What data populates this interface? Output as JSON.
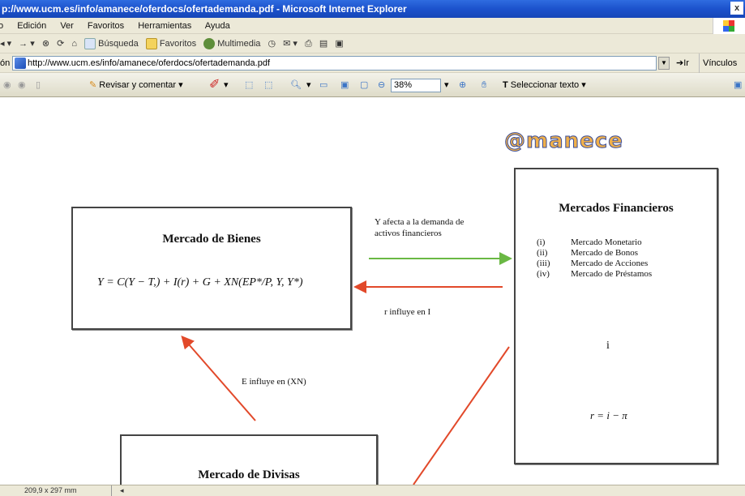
{
  "window": {
    "title": "p://www.ucm.es/info/amanece/oferdocs/ofertademanda.pdf - Microsoft Internet Explorer",
    "close": "x"
  },
  "menu": [
    "o",
    "Edición",
    "Ver",
    "Favoritos",
    "Herramientas",
    "Ayuda"
  ],
  "toolbar": {
    "search": "Búsqueda",
    "favorites": "Favoritos",
    "multimedia": "Multimedia"
  },
  "address": {
    "label": "ón",
    "url": "http://www.ucm.es/info/amanece/oferdocs/ofertademanda.pdf",
    "go": "Ir",
    "links": "Vínculos"
  },
  "pdf_toolbar": {
    "review": "Revisar y comentar",
    "zoom": "38%",
    "select_text": "Seleccionar texto"
  },
  "document": {
    "logo": "@manece",
    "bienes": {
      "title": "Mercado de Bienes",
      "formula": "Y = C(Y − T,) + I(r) + G + XN(EP*/P, Y, Y*)"
    },
    "financieros": {
      "title": "Mercados Financieros",
      "items": [
        {
          "num": "(i)",
          "label": "Mercado Monetario"
        },
        {
          "num": "(ii)",
          "label": "Mercado de Bonos"
        },
        {
          "num": "(iii)",
          "label": "Mercado de Acciones"
        },
        {
          "num": "(iv)",
          "label": "Mercado de Préstamos"
        }
      ],
      "i_label": "i",
      "r_formula": "r = i − π"
    },
    "divisas": {
      "title": "Mercado de Divisas"
    },
    "arrows": {
      "y_affects_line1": "Y afecta a la demanda de",
      "y_affects_line2": "activos financieros",
      "r_influye": "r influye en I",
      "e_influye": "E influye en (XN)"
    }
  },
  "status": {
    "page_size": "209,9 x 297 mm",
    "prev": "◂"
  },
  "colors": {
    "arrow_red": "#e2492a",
    "arrow_green": "#6ab844",
    "title_blue": "#1c52cc"
  }
}
